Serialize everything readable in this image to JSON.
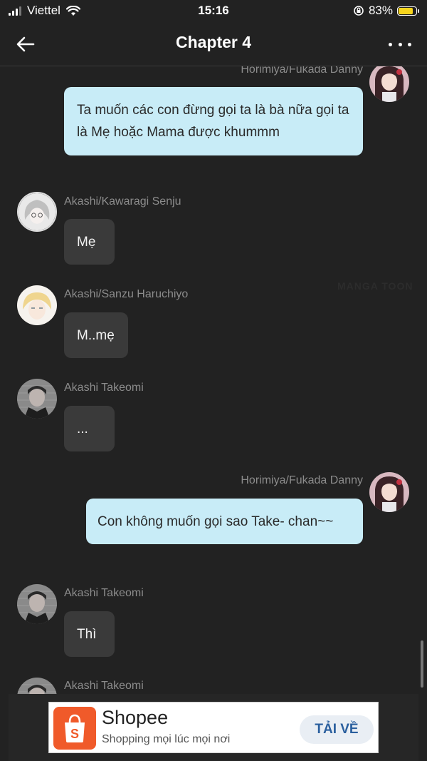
{
  "status_bar": {
    "carrier": "Viettel",
    "time": "15:16",
    "battery": "83%",
    "battery_level": 0.83
  },
  "nav": {
    "title": "Chapter 4"
  },
  "messages": [
    {
      "sender": "Horimiya/Fukada Danny",
      "text": "Ta muốn các con đừng gọi ta là bà nữa gọi ta là Mẹ hoặc Mama được khummm",
      "side": "right"
    },
    {
      "sender": "Akashi/Kawaragi Senju",
      "text": "Mẹ",
      "side": "left"
    },
    {
      "sender": "Akashi/Sanzu Haruchiyo",
      "text": "M..mẹ",
      "side": "left"
    },
    {
      "sender": "Akashi Takeomi",
      "text": "...",
      "side": "left"
    },
    {
      "sender": "Horimiya/Fukada Danny",
      "text": "Con không muốn gọi sao Take- chan~~",
      "side": "right"
    },
    {
      "sender": "Akashi Takeomi",
      "text": "Thì",
      "side": "left"
    },
    {
      "sender": "Akashi Takeomi",
      "text": "",
      "side": "left"
    }
  ],
  "watermark": "MANGA TOON",
  "ad": {
    "brand": "Shopee",
    "tagline": "Shopping mọi lúc mọi nơi",
    "cta": "TẢI VỀ",
    "brand_color": "#f05a2a"
  },
  "colors": {
    "background": "#222222",
    "outgoing_bubble": "#c8ecf7",
    "incoming_bubble": "#3a3a3a"
  }
}
